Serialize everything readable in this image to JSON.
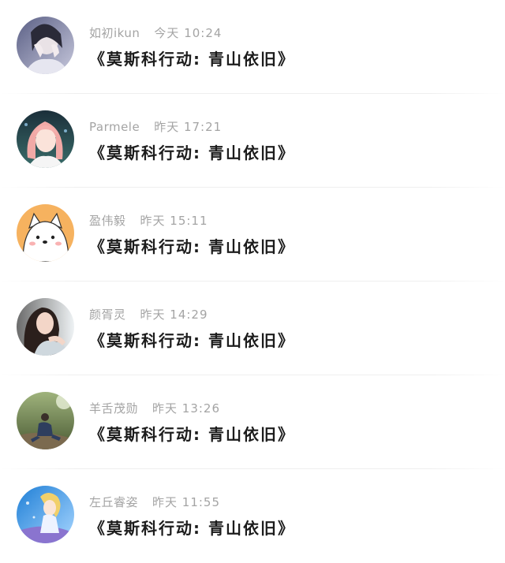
{
  "comments": [
    {
      "name": "如初ikun",
      "time": "今天 10:24",
      "message": "《莫斯科行动: 青山依旧》",
      "avatar": "girl-covering-face-avatar"
    },
    {
      "name": "Parmele",
      "time": "昨天 17:21",
      "message": "《莫斯科行动: 青山依旧》",
      "avatar": "pink-hair-girl-avatar"
    },
    {
      "name": "盈伟毅",
      "time": "昨天 15:11",
      "message": "《莫斯科行动: 青山依旧》",
      "avatar": "cartoon-puppy-avatar"
    },
    {
      "name": "颜胥灵",
      "time": "昨天 14:29",
      "message": "《莫斯科行动: 青山依旧》",
      "avatar": "long-hair-woman-avatar"
    },
    {
      "name": "羊舌茂勋",
      "time": "昨天 13:26",
      "message": "《莫斯科行动: 青山依旧》",
      "avatar": "man-sitting-in-nature-avatar"
    },
    {
      "name": "左丘睿姿",
      "time": "昨天 11:55",
      "message": "《莫斯科行动: 青山依旧》",
      "avatar": "anime-girl-blue-sky-avatar"
    }
  ]
}
